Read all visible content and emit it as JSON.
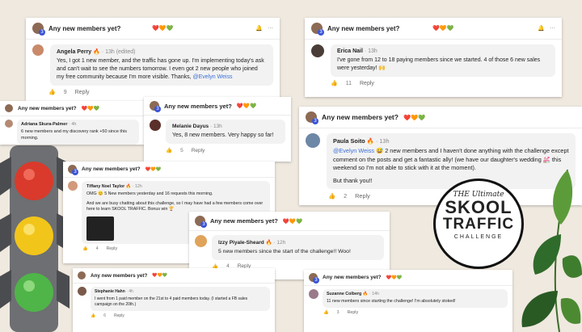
{
  "post_title": "Any new members yet?",
  "hearts": "❤️🧡💚",
  "cards": [
    {
      "author": "Angela Perry 🔥",
      "meta": "· 13h (edited)",
      "text": "Yes, I got 1 new member, and the traffic has gone up. I'm implementing today's ask and can't wait to see the numbers tomorrow. I even got 2 new people who joined my free community because I'm more visible. Thanks,",
      "mention": "@Evelyn Weiss",
      "likes": "9",
      "reply": "Reply"
    },
    {
      "author": "Erica Nail",
      "meta": "· 13h",
      "text": "I've gone from 12 to 18 paying members since we started. 4 of those 6 new sales were yesterday! 🙌",
      "likes": "11",
      "reply": "Reply"
    },
    {
      "author": "Adriana Skura-Palmer",
      "meta": "· 4h",
      "text": "6 new members and my discovery rank +50 since this morning.",
      "likes": "",
      "reply": ""
    },
    {
      "author": "Melanie Dayus",
      "meta": "· 13h",
      "text": "Yes, 8 new members. Very happy so far!",
      "likes": "5",
      "reply": "Reply"
    },
    {
      "author": "Paula Soito 🔥",
      "meta": "· 13h",
      "mention": "@Evelyn Weiss",
      "text": "😅 2 new members and I haven't done anything with the challenge except comment on the posts and get a fantastic ally! (we have our daughter's wedding 💒 this weekend so I'm not able to stick with it at the moment).",
      "text2": "But thank you!!",
      "likes": "2",
      "reply": "Reply"
    },
    {
      "author": "Tiffany Noel Taylor 🔥",
      "meta": "· 12h",
      "text": "OMG 😊 5 New members yesterday and 16 requests this morning.",
      "text2": "And we are busy chatting about this challenge, so I may have had a few members come over here to learn SKOOL TRAFFIC. Bonus win 🏆",
      "likes": "4",
      "reply": "Reply"
    },
    {
      "author": "Izzy Piyale-Sheard 🔥",
      "meta": "· 12h",
      "text": "5 new members since the start of the challenge!! Woo!",
      "likes": "4",
      "reply": "Reply"
    },
    {
      "author": "Stephanie Hahn",
      "meta": "· 4h",
      "text": "I went from 1 paid member on the 21st to 4 paid members today. (I started a FB sales campaign on the 20th.)",
      "likes": "6",
      "reply": "Reply"
    },
    {
      "author": "Suzanne Colberg 🔥",
      "meta": "· 14h",
      "text": "11 new members since starting the challenge! I'm absolutely stoked!",
      "likes": "3",
      "reply": "Reply"
    }
  ],
  "seal": {
    "line1": "THE Ultimate",
    "line2": "SKOOL",
    "line3": "TRAFFIC",
    "line4": "CHALLENGE"
  },
  "icons": {
    "like": "thumbs-up-icon",
    "bell": "bell-icon",
    "more": "ellipsis-icon"
  },
  "colors": {
    "mention": "#3a6fd8",
    "level_badge": "#3a54d6"
  }
}
